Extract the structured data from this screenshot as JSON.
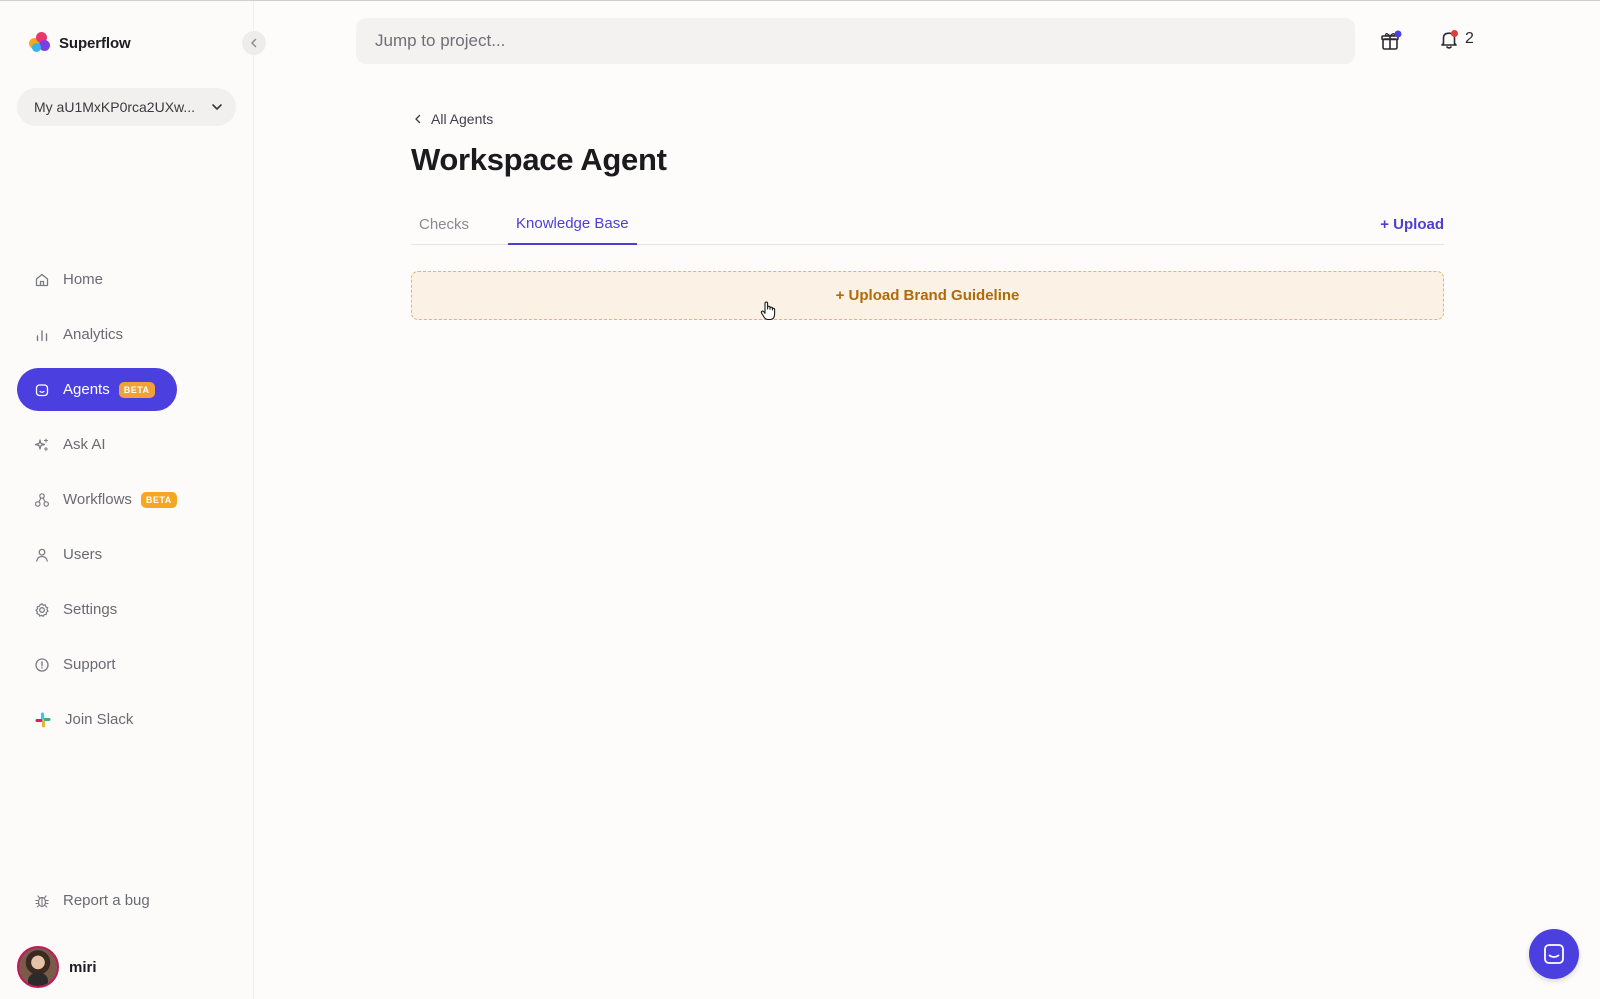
{
  "brand": {
    "name": "Superflow"
  },
  "workspace": {
    "selected": "My aU1MxKP0rca2UXw..."
  },
  "nav": {
    "items": [
      {
        "label": "Home",
        "icon": "home-icon"
      },
      {
        "label": "Analytics",
        "icon": "bar-chart-icon"
      },
      {
        "label": "Agents",
        "icon": "agent-icon",
        "badge": "BETA",
        "active": true
      },
      {
        "label": "Ask AI",
        "icon": "sparkle-icon"
      },
      {
        "label": "Workflows",
        "icon": "workflow-icon",
        "badge": "BETA"
      },
      {
        "label": "Users",
        "icon": "user-icon"
      },
      {
        "label": "Settings",
        "icon": "gear-icon"
      },
      {
        "label": "Support",
        "icon": "info-icon"
      },
      {
        "label": "Join Slack",
        "icon": "slack-icon"
      }
    ],
    "report_bug": "Report a bug"
  },
  "user": {
    "name": "miri"
  },
  "search": {
    "placeholder": "Jump to project..."
  },
  "notifications": {
    "count": "2"
  },
  "main": {
    "breadcrumb": "All Agents",
    "title": "Workspace Agent",
    "tabs": [
      {
        "label": "Checks",
        "active": false
      },
      {
        "label": "Knowledge Base",
        "active": true
      }
    ],
    "upload_label": "+ Upload",
    "upload_guideline_label": "+ Upload Brand Guideline"
  },
  "colors": {
    "accent": "#4b3fe0",
    "badge": "#f5a623",
    "upload_bg": "#fbf1e4",
    "upload_text": "#b06a08"
  }
}
